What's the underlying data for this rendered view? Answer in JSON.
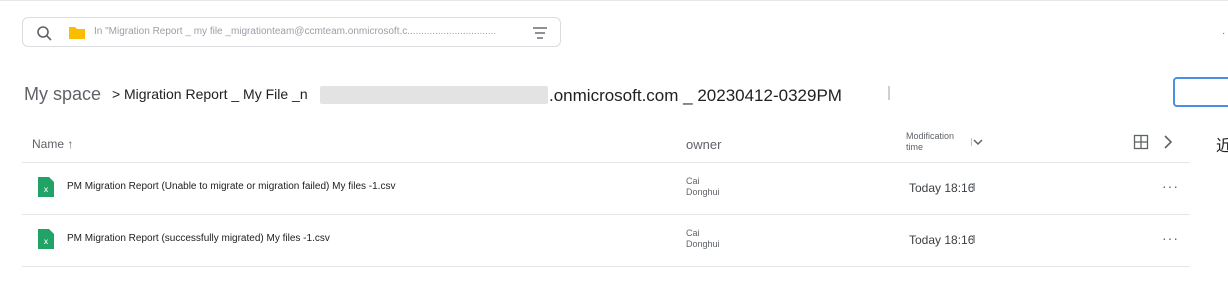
{
  "search": {
    "scope_text": "In \"Migration Report _ my file _migrationteam@ccmteam.onmicrosoft.c................................"
  },
  "breadcrumb": {
    "root": "My space",
    "separator": ">",
    "segment_a": "Migration Report _ My File _n",
    "segment_b": ".onmicrosoft.com _ 20230412-0329PM"
  },
  "table": {
    "columns": {
      "name": "Name ↑",
      "owner": "owner",
      "modification": "Modification time"
    },
    "rows": [
      {
        "name": "PM Migration Report (Unable to migrate or migration failed) My files -1.csv",
        "owner": "Cai Donghui",
        "modified": "Today 18:16",
        "more": "···"
      },
      {
        "name": "PM Migration Report (successfully migrated) My files -1.csv",
        "owner": "Cai Donghui",
        "modified": "Today 18:16",
        "more": "···"
      }
    ]
  },
  "side_text": "近",
  "colors": {
    "folder": "#fbbc04",
    "excel": "#21a366",
    "focus": "#4a90e2"
  }
}
